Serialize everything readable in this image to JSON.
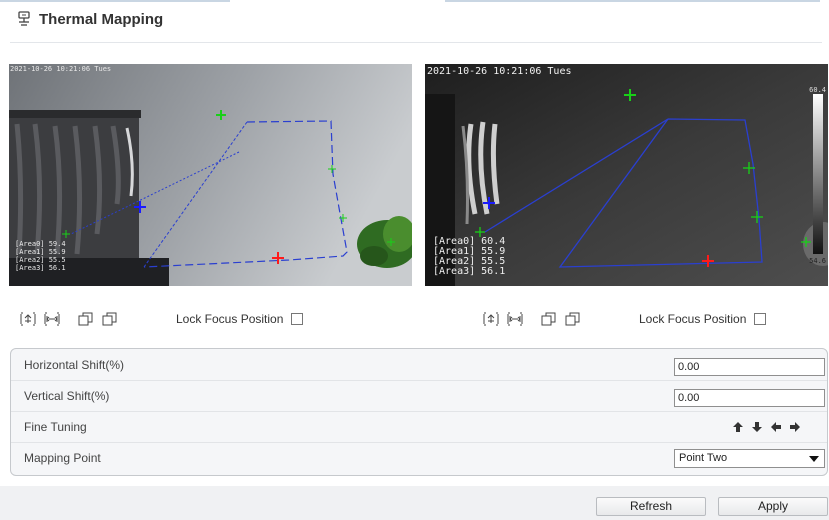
{
  "page": {
    "title": "Thermal Mapping"
  },
  "video_left": {
    "timestamp": "2021-10-26 10:21:06 Tues",
    "areas": [
      "[Area0] 59.4",
      "[Area1] 55.9",
      "[Area2] 55.5",
      "[Area3] 56.1"
    ]
  },
  "video_right": {
    "timestamp": "2021-10-26 10:21:06 Tues",
    "areas": [
      "[Area0] 60.4",
      "[Area1] 55.9",
      "[Area2] 55.5",
      "[Area3] 56.1"
    ],
    "scale_max": "60.4",
    "scale_min": "54.6"
  },
  "controls": {
    "lock_focus_label": "Lock Focus Position",
    "icons": [
      "zoom-in-icon",
      "zoom-out-icon",
      "window-a-icon",
      "window-b-icon"
    ]
  },
  "settings": {
    "horizontal_shift_label": "Horizontal Shift(%)",
    "horizontal_shift_value": "0.00",
    "vertical_shift_label": "Vertical Shift(%)",
    "vertical_shift_value": "0.00",
    "fine_tuning_label": "Fine Tuning",
    "mapping_point_label": "Mapping Point",
    "mapping_point_value": "Point Two"
  },
  "buttons": {
    "refresh": "Refresh",
    "apply": "Apply"
  },
  "colors": {
    "panel_bg": "#f5f6f8",
    "overlay_line": "#2a3fd0",
    "marker_green": "#18d018",
    "marker_red": "#ff1a1a",
    "marker_blue": "#1a1aff"
  }
}
